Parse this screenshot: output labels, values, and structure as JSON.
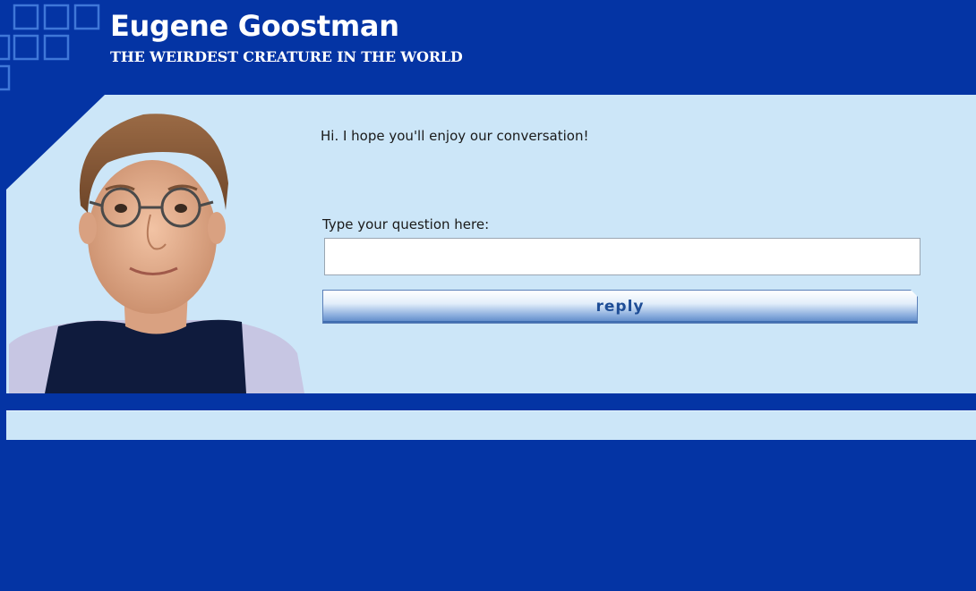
{
  "header": {
    "title": "Eugene Goostman",
    "subtitle": "THE WEIRDEST CREATURE IN THE WORLD"
  },
  "chat": {
    "bot_message": "Hi. I hope you'll enjoy our conversation!",
    "input_label": "Type your question here:",
    "input_value": "",
    "reply_label": "reply"
  },
  "avatar": {
    "icon": "avatar-portrait"
  },
  "colors": {
    "background": "#0434a4",
    "panel": "#cce6f8",
    "button_text": "#1e4d96"
  }
}
